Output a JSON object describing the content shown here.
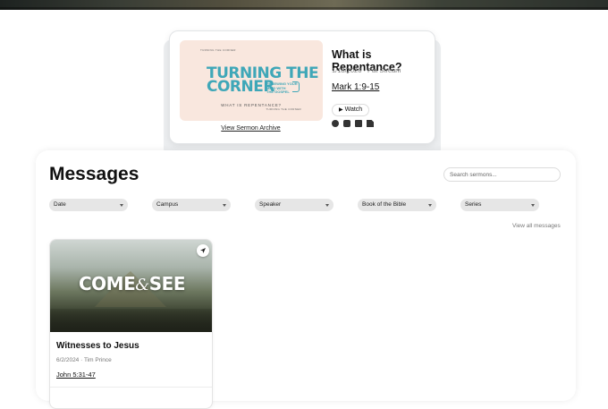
{
  "featured": {
    "thumbnail": {
      "corner_text": "TURNING THE CORNER",
      "title_line1": "TURNING THE",
      "title_line2": "CORNER",
      "side_line1": "RENEWING YOUR",
      "side_line2": "MIND WITH",
      "side_line3": "THE GOSPEL",
      "subtitle": "WHAT IS REPENTANCE?",
      "corner_text2": "TURNING THE CORNER"
    },
    "archive_link": "View Sermon Archive",
    "title": "What is Repentance?",
    "meta": "1/18/2026 · Pat Stream",
    "scripture": "Mark 1:9-15",
    "watch_label": "Watch",
    "platform_icons": [
      "spotify-icon",
      "apple-podcasts-icon",
      "podcast-icon",
      "notes-icon"
    ]
  },
  "messages": {
    "heading": "Messages",
    "search_placeholder": "Search sermons...",
    "filters": [
      "Date",
      "Campus",
      "Speaker",
      "Book of the Bible",
      "Series"
    ],
    "view_all": "View all messages",
    "cards": [
      {
        "image_title": "COME & SEE",
        "image_text_left": "COME",
        "image_text_amp": "&",
        "image_text_right": "SEE",
        "title": "Witnesses to Jesus",
        "meta": "6/2/2024 · Tim Prince",
        "scripture": "John 5:31-47"
      }
    ]
  }
}
